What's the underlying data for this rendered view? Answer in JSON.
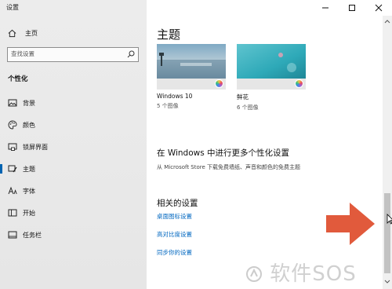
{
  "window": {
    "title": "设置"
  },
  "sidebar": {
    "home": "主页",
    "search_placeholder": "查找设置",
    "section": "个性化",
    "items": [
      {
        "label": "背景",
        "icon": "image-icon"
      },
      {
        "label": "颜色",
        "icon": "palette-icon"
      },
      {
        "label": "锁屏界面",
        "icon": "lock-screen-icon"
      },
      {
        "label": "主题",
        "icon": "brush-icon",
        "active": true
      },
      {
        "label": "字体",
        "icon": "font-icon"
      },
      {
        "label": "开始",
        "icon": "start-icon"
      },
      {
        "label": "任务栏",
        "icon": "taskbar-icon"
      }
    ]
  },
  "main": {
    "title": "主题",
    "themes": [
      {
        "name": "Windows 10",
        "count": "5 个图像"
      },
      {
        "name": "鲜花",
        "count": "6 个图像"
      }
    ],
    "personalize_heading": "在 Windows 中进行更多个性化设置",
    "personalize_sub": "从 Microsoft Store 下载免费墙纸、声音和颜色的免费主题",
    "related_heading": "相关的设置",
    "links": [
      "桌面图标设置",
      "高对比度设置",
      "同步你的设置"
    ]
  },
  "overlay": {
    "watermark": "软件SOS"
  },
  "colors": {
    "accent": "#0063b1",
    "link": "#0067c0",
    "arrow": "#e15a3c"
  }
}
